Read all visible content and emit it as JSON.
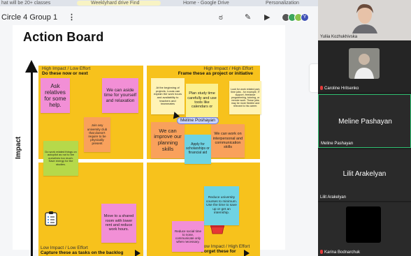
{
  "browser": {
    "tabs": [
      "hat will be 20+ classes",
      "Weeklyhard drive Find",
      "Home - Google Drive",
      "Personalization"
    ]
  },
  "board": {
    "name": "Circle 4 Group 1",
    "menu": "⋮",
    "tools": [
      "ಠ",
      "✎",
      "▶"
    ],
    "avatar_colors": [
      "#555555",
      "#3ba55d",
      "#8bc34a",
      "#3f51b5"
    ],
    "avatar_badge": "Y"
  },
  "action_board": {
    "title": "Action Board",
    "axis_label": "Impact",
    "quadrants": {
      "top_left": {
        "line1": "High Impact / Low Effort",
        "line2": "Do these now or next"
      },
      "top_right": {
        "line1": "High Impact / High Effort",
        "line2": "Frame these as project or initiative"
      },
      "bottom_left": {
        "line1": "Low Impact / Low Effort",
        "line2": "Capture these as tasks on the backlog"
      },
      "bottom_right": {
        "line1": "Low Impact / High Effort",
        "line2": "Forget these for"
      }
    },
    "stickies": [
      {
        "text": "Ask relatives for some help."
      },
      {
        "text": "We can aside time for yourself and relaxation"
      },
      {
        "text": "Join any university club that doesn't require to be physically present"
      },
      {
        "text": "Do work related things on autopilot as not to tire ourselves too much. Save energy for the studies."
      },
      {
        "text": "At the beginning of projects, Lucas can explain the work hours and availability to teachers and teammates"
      },
      {
        "text": "Plan study time carefully and use tools like calendars or"
      },
      {
        "text": "Look for work related part-time jobs - for example, IT support, freelance programming, tutoring, or remote work. These jobs may be more flexible and relevant to his career."
      },
      {
        "text": "We can improve our planning skills"
      },
      {
        "text": "Apply for scholarships or financial aid"
      },
      {
        "text": "We can work on interpersonal and communication skills"
      },
      {
        "text": "Move to a shared room with lower rent and reduce work hours."
      },
      {
        "text": "Reduce university courses to minimum. Use the time to save up or get an internship."
      },
      {
        "text": "Reduce social time to none, communicate only when necessary."
      }
    ],
    "cursor_name": "Meline Poshayan"
  },
  "participants": [
    {
      "name": "Yuliia Kozhukhivska",
      "muted": false
    },
    {
      "name": "Caroline Hritsenko",
      "muted": true
    },
    {
      "name": "Meline Pashayan",
      "display": "Meline Pashayan",
      "muted": false
    },
    {
      "name": "Lilit Arakelyan",
      "display": "Lilit Arakelyan",
      "muted": false
    },
    {
      "name": "Karina Bodnarchuk",
      "muted": true
    }
  ]
}
